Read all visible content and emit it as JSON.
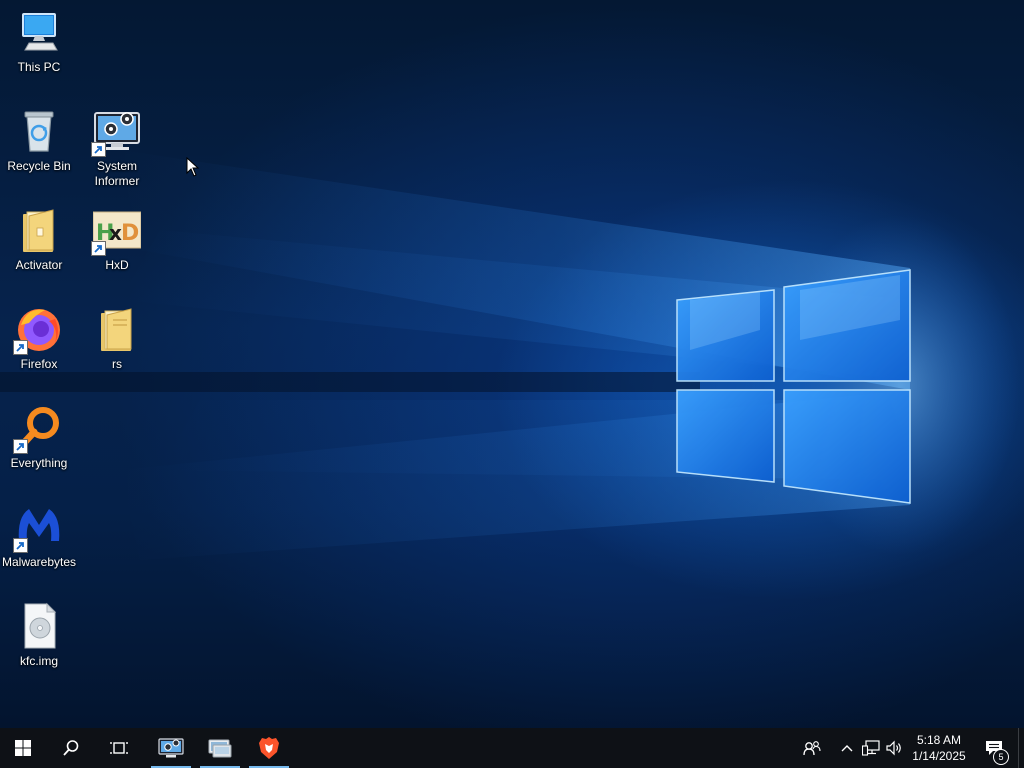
{
  "desktop": {
    "icons": [
      {
        "label": "This PC"
      },
      {
        "label": "Recycle Bin"
      },
      {
        "label": "System Informer"
      },
      {
        "label": "Activator"
      },
      {
        "label": "HxD"
      },
      {
        "label": "Firefox"
      },
      {
        "label": "rs"
      },
      {
        "label": "Everything"
      },
      {
        "label": "Malwarebytes"
      },
      {
        "label": "kfc.img"
      }
    ]
  },
  "taskbar": {
    "start_icon": "windows-logo-icon",
    "pinned_apps": [
      "system-informer-icon",
      "control-panel-icon",
      "brave-browser-icon"
    ],
    "clock": {
      "time": "5:18 AM",
      "date": "1/14/2025"
    },
    "notification_count": "5",
    "colors": {
      "taskbar": "#0e1116",
      "accent_underline": "#76b9ed"
    }
  }
}
